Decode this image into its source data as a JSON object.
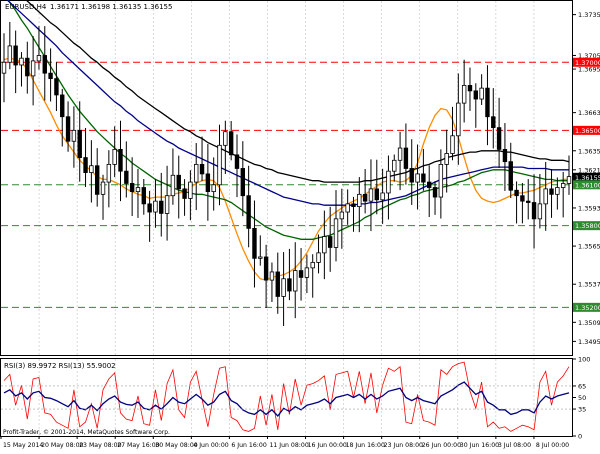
{
  "header": {
    "symbol_text": "EURUSD,H4",
    "ohlc_text": "1.36171 1.36198 1.36135 1.36155",
    "rsi_text": "RSI(3) 89.9972  RSI(13) 55.9002"
  },
  "footer": {
    "copyright": "Profit-Trader, © 2001-2014, MetaQuotes Software Corp."
  },
  "colors": {
    "background": "#ffffff",
    "grid": "#c0c0c0",
    "candle": "#000000",
    "resistance_line": "#ff0000",
    "support_line": "#2e8b2e",
    "ma_orange": "#ff8c00",
    "ma_darkgreen": "#006400",
    "ma_navy": "#00008b",
    "ma_black": "#000000",
    "rsi_fast": "#ff0000",
    "rsi_slow": "#000080"
  },
  "chart_data": [
    {
      "type": "candlestick",
      "title": "EURUSD,H4",
      "y_ticks": [
        "1.37350",
        "1.37050",
        "1.36950",
        "1.36630",
        "1.36350",
        "1.36210",
        "1.35930",
        "1.35650",
        "1.35370",
        "1.35090",
        "1.34950"
      ],
      "ylim": [
        1.3485,
        1.3745
      ],
      "x_ticks": [
        "15 May 2014",
        "20 May 08:00",
        "23 May 08:00",
        "27 May 16:00",
        "30 May 08:00",
        "4 Jun 00:00",
        "6 Jun 16:00",
        "11 Jun 08:00",
        "16 Jun 00:00",
        "18 Jun 16:00",
        "23 Jun 08:00",
        "26 Jun 00:00",
        "30 Jun 16:00",
        "3 Jul 08:00",
        "8 Jul 00:00"
      ],
      "price_labels": [
        {
          "text": "1.37000",
          "value": 1.37,
          "style": "resistance"
        },
        {
          "text": "1.36500",
          "value": 1.365,
          "style": "resistance"
        },
        {
          "text": "1.36155",
          "value": 1.36155,
          "style": "current"
        },
        {
          "text": "1.36100",
          "value": 1.361,
          "style": "support"
        },
        {
          "text": "1.35800",
          "value": 1.358,
          "style": "support"
        },
        {
          "text": "1.35200",
          "value": 1.352,
          "style": "support"
        }
      ],
      "horizontal_lines": [
        {
          "value": 1.37,
          "color": "red"
        },
        {
          "value": 1.365,
          "color": "red"
        },
        {
          "value": 1.361,
          "color": "green"
        },
        {
          "value": 1.358,
          "color": "green"
        },
        {
          "value": 1.352,
          "color": "green"
        }
      ],
      "candles_close": [
        1.37,
        1.3712,
        1.3698,
        1.3703,
        1.369,
        1.3701,
        1.3705,
        1.3692,
        1.3688,
        1.3676,
        1.366,
        1.3642,
        1.365,
        1.363,
        1.3619,
        1.3624,
        1.3603,
        1.3612,
        1.3625,
        1.3636,
        1.362,
        1.3611,
        1.3605,
        1.3608,
        1.3596,
        1.359,
        1.3598,
        1.3589,
        1.3602,
        1.3617,
        1.3607,
        1.36,
        1.3612,
        1.3625,
        1.3618,
        1.3605,
        1.361,
        1.3639,
        1.3649,
        1.3632,
        1.3622,
        1.3602,
        1.3578,
        1.3556,
        1.3557,
        1.354,
        1.3546,
        1.3528,
        1.3541,
        1.3532,
        1.3547,
        1.3542,
        1.3549,
        1.3553,
        1.356,
        1.3572,
        1.3564,
        1.3585,
        1.359,
        1.3596,
        1.3594,
        1.3603,
        1.3598,
        1.3607,
        1.3599,
        1.3604,
        1.362,
        1.3628,
        1.3637,
        1.3622,
        1.3612,
        1.3618,
        1.3612,
        1.3608,
        1.3601,
        1.3625,
        1.3633,
        1.3646,
        1.367,
        1.3683,
        1.3679,
        1.3673,
        1.3681,
        1.366,
        1.3652,
        1.3636,
        1.3627,
        1.3606,
        1.3602,
        1.3598,
        1.3597,
        1.3585,
        1.3596,
        1.3607,
        1.3603,
        1.3608,
        1.3611,
        1.3616
      ],
      "moving_averages": [
        {
          "color": "orange",
          "values": [
            1.3702,
            1.3703,
            1.3702,
            1.37,
            1.3695,
            1.3687,
            1.3679,
            1.3671,
            1.3663,
            1.3654,
            1.3646,
            1.364,
            1.3634,
            1.3628,
            1.3624,
            1.362,
            1.3616,
            1.3614,
            1.3614,
            1.3612,
            1.361,
            1.3607,
            1.3605,
            1.3603,
            1.3602,
            1.36,
            1.3601,
            1.3601,
            1.3601,
            1.3603,
            1.3604,
            1.3605,
            1.3608,
            1.3611,
            1.3613,
            1.3614,
            1.3613,
            1.3608,
            1.3598,
            1.3586,
            1.3574,
            1.3563,
            1.3554,
            1.3546,
            1.3541,
            1.354,
            1.3542,
            1.3543,
            1.3544,
            1.3546,
            1.3549,
            1.3554,
            1.356,
            1.3568,
            1.3576,
            1.3582,
            1.3587,
            1.359,
            1.3593,
            1.3596,
            1.3598,
            1.36,
            1.3603,
            1.3606,
            1.3609,
            1.3612,
            1.3613,
            1.3613,
            1.3612,
            1.3613,
            1.3617,
            1.3626,
            1.364,
            1.3652,
            1.3661,
            1.3666,
            1.3665,
            1.3658,
            1.3645,
            1.363,
            1.3616,
            1.3606,
            1.36,
            1.3598,
            1.3597,
            1.3598,
            1.36,
            1.3602,
            1.3604,
            1.3604,
            1.3605,
            1.3606,
            1.3608,
            1.361,
            1.3612,
            1.3613,
            1.3614,
            1.3614
          ]
        },
        {
          "color": "darkgreen",
          "values": [
            1.375,
            1.3744,
            1.3738,
            1.3731,
            1.3725,
            1.3718,
            1.3711,
            1.3704,
            1.3697,
            1.369,
            1.3683,
            1.3676,
            1.367,
            1.3664,
            1.3659,
            1.3654,
            1.3649,
            1.3645,
            1.3641,
            1.3637,
            1.3633,
            1.363,
            1.3626,
            1.3623,
            1.362,
            1.3617,
            1.3614,
            1.3612,
            1.361,
            1.3608,
            1.3606,
            1.3605,
            1.3604,
            1.3603,
            1.3603,
            1.3602,
            1.3601,
            1.36,
            1.3599,
            1.3597,
            1.3594,
            1.3591,
            1.3588,
            1.3585,
            1.3582,
            1.3579,
            1.3577,
            1.3575,
            1.3573,
            1.3572,
            1.3571,
            1.357,
            1.357,
            1.357,
            1.3571,
            1.3572,
            1.3573,
            1.3575,
            1.3577,
            1.3579,
            1.3581,
            1.3583,
            1.3586,
            1.3588,
            1.3591,
            1.3593,
            1.3595,
            1.3597,
            1.3599,
            1.36,
            1.3602,
            1.3603,
            1.3605,
            1.3606,
            1.3607,
            1.3608,
            1.3609,
            1.361,
            1.3612,
            1.3613,
            1.3615,
            1.3617,
            1.3619,
            1.362,
            1.3621,
            1.3621,
            1.3621,
            1.362,
            1.3619,
            1.3618,
            1.3617,
            1.3616,
            1.3615,
            1.3614,
            1.3614,
            1.3613,
            1.3613,
            1.3613
          ]
        },
        {
          "color": "navy",
          "values": [
            1.3748,
            1.3744,
            1.374,
            1.3736,
            1.3732,
            1.3728,
            1.3724,
            1.372,
            1.3716,
            1.3712,
            1.3707,
            1.3703,
            1.3699,
            1.3695,
            1.3691,
            1.3687,
            1.3683,
            1.3679,
            1.3675,
            1.3671,
            1.3668,
            1.3664,
            1.3661,
            1.3657,
            1.3654,
            1.3651,
            1.3648,
            1.3645,
            1.3642,
            1.364,
            1.3637,
            1.3635,
            1.3633,
            1.3631,
            1.3629,
            1.3627,
            1.3625,
            1.3623,
            1.3621,
            1.3619,
            1.3617,
            1.3615,
            1.3613,
            1.3611,
            1.3609,
            1.3607,
            1.3605,
            1.3603,
            1.3601,
            1.36,
            1.3599,
            1.3598,
            1.3597,
            1.3596,
            1.3596,
            1.3595,
            1.3595,
            1.3595,
            1.3595,
            1.3595,
            1.3595,
            1.3596,
            1.3596,
            1.3597,
            1.3597,
            1.3598,
            1.3599,
            1.36,
            1.3601,
            1.3602,
            1.3604,
            1.3606,
            1.3608,
            1.361,
            1.3612,
            1.3614,
            1.3615,
            1.3616,
            1.3617,
            1.3618,
            1.3619,
            1.362,
            1.3621,
            1.3622,
            1.3623,
            1.3623,
            1.3623,
            1.3623,
            1.3623,
            1.3623,
            1.3622,
            1.3622,
            1.3622,
            1.3622,
            1.3621,
            1.3621,
            1.3621,
            1.3621
          ]
        },
        {
          "color": "black",
          "values": [
            1.376,
            1.3756,
            1.3752,
            1.3748,
            1.3745,
            1.3741,
            1.3737,
            1.3733,
            1.3729,
            1.3726,
            1.3722,
            1.3718,
            1.3714,
            1.3711,
            1.3707,
            1.3703,
            1.37,
            1.3696,
            1.3693,
            1.3689,
            1.3686,
            1.3682,
            1.3679,
            1.3675,
            1.3672,
            1.3669,
            1.3666,
            1.3663,
            1.366,
            1.3657,
            1.3654,
            1.3651,
            1.3649,
            1.3646,
            1.3644,
            1.3641,
            1.3639,
            1.3637,
            1.3635,
            1.3633,
            1.3631,
            1.3629,
            1.3627,
            1.3625,
            1.3624,
            1.3622,
            1.3621,
            1.3619,
            1.3618,
            1.3617,
            1.3616,
            1.3615,
            1.3614,
            1.3613,
            1.3613,
            1.3612,
            1.3612,
            1.3612,
            1.3612,
            1.3612,
            1.3612,
            1.3612,
            1.3613,
            1.3613,
            1.3614,
            1.3615,
            1.3616,
            1.3617,
            1.3618,
            1.3619,
            1.3621,
            1.3622,
            1.3624,
            1.3625,
            1.3627,
            1.3628,
            1.363,
            1.3631,
            1.3632,
            1.3633,
            1.3634,
            1.3634,
            1.3635,
            1.3635,
            1.3635,
            1.3635,
            1.3634,
            1.3634,
            1.3633,
            1.3632,
            1.3631,
            1.363,
            1.3629,
            1.3629,
            1.3628,
            1.3628,
            1.3628,
            1.3627
          ]
        }
      ]
    },
    {
      "type": "line",
      "title": "RSI(3) 89.9972  RSI(13) 55.9002",
      "y_ticks": [
        "100",
        "65",
        "50",
        "35",
        "0"
      ],
      "ylim": [
        0,
        100
      ],
      "series": [
        {
          "name": "RSI(3)",
          "color": "red",
          "values": [
            72,
            80,
            40,
            66,
            22,
            74,
            76,
            30,
            28,
            18,
            14,
            10,
            60,
            12,
            18,
            42,
            10,
            60,
            74,
            82,
            30,
            22,
            20,
            52,
            16,
            14,
            60,
            20,
            68,
            86,
            34,
            24,
            70,
            84,
            48,
            12,
            54,
            88,
            90,
            24,
            20,
            8,
            6,
            10,
            52,
            14,
            54,
            8,
            68,
            28,
            74,
            40,
            66,
            68,
            72,
            78,
            34,
            80,
            82,
            84,
            50,
            84,
            42,
            82,
            30,
            66,
            88,
            84,
            90,
            18,
            16,
            54,
            20,
            18,
            14,
            86,
            80,
            90,
            94,
            96,
            58,
            36,
            70,
            12,
            18,
            10,
            12,
            6,
            10,
            14,
            12,
            8,
            70,
            84,
            40,
            70,
            78,
            90
          ]
        },
        {
          "name": "RSI(13)",
          "color": "navy",
          "values": [
            56,
            60,
            52,
            56,
            48,
            56,
            58,
            50,
            49,
            46,
            42,
            38,
            46,
            36,
            34,
            40,
            33,
            42,
            48,
            52,
            44,
            41,
            40,
            44,
            36,
            34,
            40,
            35,
            42,
            50,
            44,
            42,
            48,
            54,
            48,
            40,
            44,
            54,
            58,
            46,
            42,
            34,
            30,
            28,
            34,
            28,
            34,
            26,
            36,
            32,
            38,
            34,
            40,
            42,
            44,
            48,
            42,
            50,
            52,
            54,
            50,
            54,
            48,
            54,
            48,
            52,
            58,
            60,
            62,
            50,
            46,
            50,
            46,
            44,
            42,
            52,
            56,
            60,
            66,
            70,
            62,
            54,
            58,
            44,
            40,
            34,
            34,
            28,
            30,
            34,
            34,
            30,
            44,
            52,
            48,
            52,
            54,
            56
          ]
        }
      ]
    }
  ]
}
